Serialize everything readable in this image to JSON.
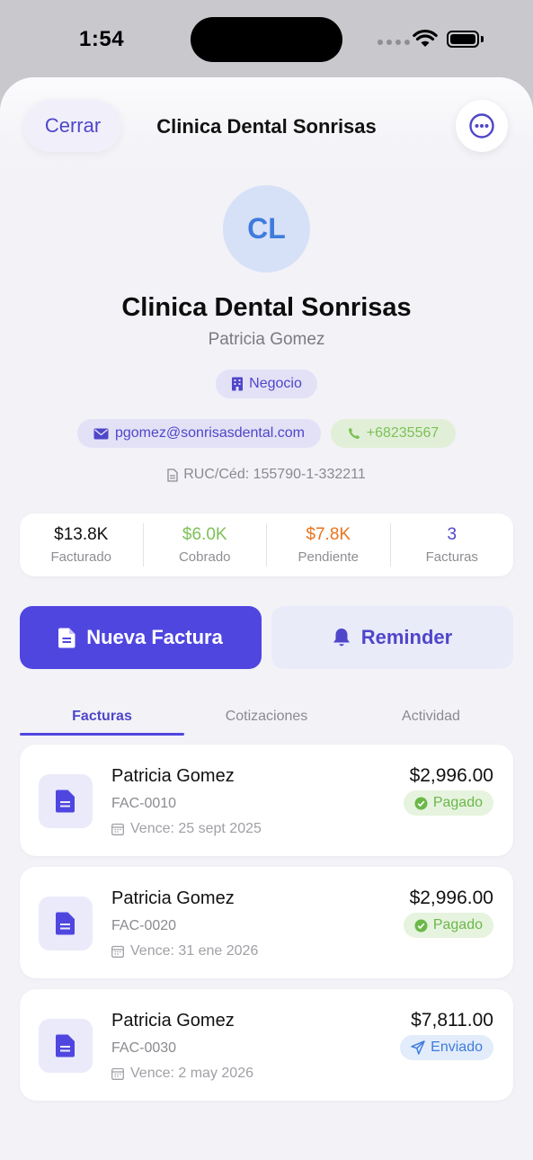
{
  "status_bar": {
    "time": "1:54"
  },
  "header": {
    "close_label": "Cerrar",
    "title": "Clinica Dental Sonrisas",
    "more_icon": "ellipsis-circle-icon"
  },
  "client": {
    "initials": "CL",
    "name": "Clinica Dental Sonrisas",
    "contact": "Patricia Gomez",
    "type": "Negocio",
    "email": "pgomez@sonrisasdental.com",
    "phone": "+68235567",
    "ruc": "RUC/Céd: 155790-1-332211"
  },
  "stats": [
    {
      "value": "$13.8K",
      "label": "Facturado",
      "color": "#111111"
    },
    {
      "value": "$6.0K",
      "label": "Cobrado",
      "color": "#7cc157"
    },
    {
      "value": "$7.8K",
      "label": "Pendiente",
      "color": "#e8741f"
    },
    {
      "value": "3",
      "label": "Facturas",
      "color": "#4f46c9"
    }
  ],
  "actions": {
    "new_invoice": "Nueva Factura",
    "reminder": "Reminder"
  },
  "tabs": [
    {
      "label": "Facturas",
      "active": true
    },
    {
      "label": "Cotizaciones",
      "active": false
    },
    {
      "label": "Actividad",
      "active": false
    }
  ],
  "invoices": [
    {
      "client": "Patricia Gomez",
      "number": "FAC-0010",
      "due": "Vence: 25 sept 2025",
      "amount": "$2,996.00",
      "status": "Pagado"
    },
    {
      "client": "Patricia Gomez",
      "number": "FAC-0020",
      "due": "Vence: 31 ene 2026",
      "amount": "$2,996.00",
      "status": "Pagado"
    },
    {
      "client": "Patricia Gomez",
      "number": "FAC-0030",
      "due": "Vence: 2 may 2026",
      "amount": "$7,811.00",
      "status": "Enviado"
    }
  ],
  "colors": {
    "accent": "#4f46e0",
    "paid": "#6bb84a",
    "sent": "#3f7bdd"
  }
}
